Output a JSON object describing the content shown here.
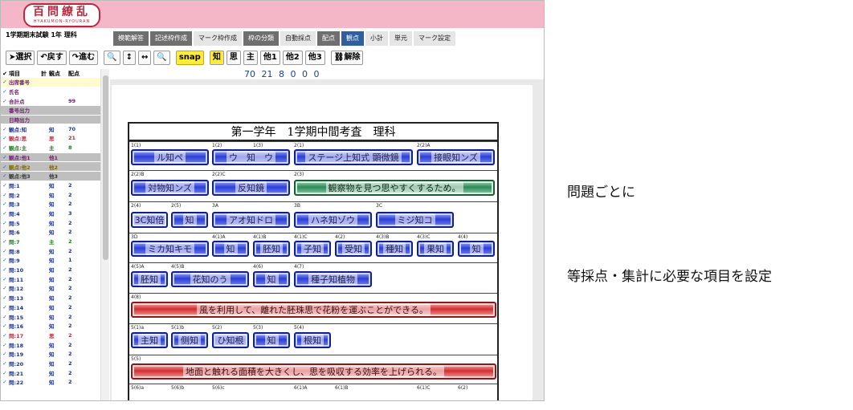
{
  "app": {
    "logo_main": "百問繚乱",
    "logo_sub": "HYAKUMON-RYOURAN",
    "exam_title": "1学期期末試験 1年 理科"
  },
  "tabs": [
    {
      "label": "模範解答",
      "style": "dark"
    },
    {
      "label": "記述枠作成",
      "style": "dark"
    },
    {
      "label": "マーク枠作成",
      "style": "light"
    },
    {
      "label": "枠の分類",
      "style": "dark"
    },
    {
      "label": "自動採点",
      "style": "light"
    },
    {
      "label": "配点",
      "style": "dark"
    },
    {
      "label": "観点",
      "style": "blue"
    },
    {
      "label": "小計",
      "style": "light"
    },
    {
      "label": "単元",
      "style": "light"
    },
    {
      "label": "マーク設定",
      "style": "light"
    }
  ],
  "toolbar": {
    "select": "選択",
    "undo": "戻す",
    "redo": "進む",
    "zoom_out": "🔍",
    "fit_height": "↕",
    "fit_width": "↔",
    "zoom_in": "🔍",
    "snap": "snap",
    "kan1": "知",
    "kan2": "思",
    "kan3": "主",
    "other1": "他1",
    "other2": "他2",
    "other3": "他3",
    "clear": "解除"
  },
  "counts": "70 21 8 0 0 0",
  "side": {
    "header": {
      "check": "✔",
      "item": "項目",
      "total": "計",
      "kanten": "観点",
      "points": "配点"
    },
    "rows": [
      {
        "c": "✓",
        "n": "出席番号",
        "k": "",
        "p": "",
        "bg": "hy",
        "color": "cl-purple"
      },
      {
        "c": "✓",
        "n": "氏名",
        "k": "",
        "p": "",
        "bg": "",
        "color": "cl-purple"
      },
      {
        "c": "✓",
        "n": "合計点",
        "k": "",
        "p": "99",
        "bg": "",
        "color": "cl-purple"
      },
      {
        "c": "",
        "n": "番号出力",
        "k": "",
        "p": "",
        "bg": "hg",
        "color": "cl-purple"
      },
      {
        "c": "",
        "n": "日時出力",
        "k": "",
        "p": "",
        "bg": "hg",
        "color": "cl-purple"
      },
      {
        "c": "✓",
        "n": "観点:知",
        "k": "知",
        "p": "70",
        "bg": "",
        "color": "cl-blue"
      },
      {
        "c": "✓",
        "n": "観点:思",
        "k": "思",
        "p": "21",
        "bg": "",
        "color": "cl-red"
      },
      {
        "c": "✓",
        "n": "観点:主",
        "k": "主",
        "p": "8",
        "bg": "",
        "color": "cl-green"
      },
      {
        "c": "✓",
        "n": "観点:他1",
        "k": "他1",
        "p": "",
        "bg": "hg",
        "color": "cl-purple"
      },
      {
        "c": "✓",
        "n": "観点:他2",
        "k": "他2",
        "p": "",
        "bg": "hg",
        "color": "cl-olive"
      },
      {
        "c": "✓",
        "n": "観点:他3",
        "k": "他3",
        "p": "",
        "bg": "hg",
        "color": "cl-dark"
      },
      {
        "c": "✓",
        "n": "問:1",
        "k": "知",
        "p": "2",
        "bg": "",
        "color": "cl-blue"
      },
      {
        "c": "✓",
        "n": "問:2",
        "k": "知",
        "p": "2",
        "bg": "",
        "color": "cl-blue"
      },
      {
        "c": "✓",
        "n": "問:3",
        "k": "知",
        "p": "2",
        "bg": "",
        "color": "cl-blue"
      },
      {
        "c": "✓",
        "n": "問:4",
        "k": "知",
        "p": "3",
        "bg": "",
        "color": "cl-blue"
      },
      {
        "c": "✓",
        "n": "問:5",
        "k": "知",
        "p": "2",
        "bg": "",
        "color": "cl-blue"
      },
      {
        "c": "✓",
        "n": "問:6",
        "k": "知",
        "p": "2",
        "bg": "",
        "color": "cl-blue"
      },
      {
        "c": "✓",
        "n": "問:7",
        "k": "主",
        "p": "2",
        "bg": "",
        "color": "cl-green"
      },
      {
        "c": "✓",
        "n": "問:8",
        "k": "知",
        "p": "2",
        "bg": "",
        "color": "cl-blue"
      },
      {
        "c": "✓",
        "n": "問:9",
        "k": "知",
        "p": "1",
        "bg": "",
        "color": "cl-blue"
      },
      {
        "c": "✓",
        "n": "問:10",
        "k": "知",
        "p": "2",
        "bg": "",
        "color": "cl-blue"
      },
      {
        "c": "✓",
        "n": "問:11",
        "k": "知",
        "p": "2",
        "bg": "",
        "color": "cl-blue"
      },
      {
        "c": "✓",
        "n": "問:12",
        "k": "知",
        "p": "2",
        "bg": "",
        "color": "cl-blue"
      },
      {
        "c": "✓",
        "n": "問:13",
        "k": "知",
        "p": "2",
        "bg": "",
        "color": "cl-blue"
      },
      {
        "c": "✓",
        "n": "問:14",
        "k": "知",
        "p": "2",
        "bg": "",
        "color": "cl-blue"
      },
      {
        "c": "✓",
        "n": "問:15",
        "k": "知",
        "p": "2",
        "bg": "",
        "color": "cl-blue"
      },
      {
        "c": "✓",
        "n": "問:16",
        "k": "知",
        "p": "2",
        "bg": "",
        "color": "cl-blue"
      },
      {
        "c": "✓",
        "n": "問:17",
        "k": "思",
        "p": "2",
        "bg": "",
        "color": "cl-red"
      },
      {
        "c": "✓",
        "n": "問:18",
        "k": "知",
        "p": "2",
        "bg": "",
        "color": "cl-blue"
      },
      {
        "c": "✓",
        "n": "問:19",
        "k": "知",
        "p": "2",
        "bg": "",
        "color": "cl-blue"
      },
      {
        "c": "✓",
        "n": "問:20",
        "k": "知",
        "p": "2",
        "bg": "",
        "color": "cl-blue"
      },
      {
        "c": "✓",
        "n": "問:21",
        "k": "知",
        "p": "2",
        "bg": "",
        "color": "cl-blue"
      },
      {
        "c": "✓",
        "n": "問:22",
        "k": "知",
        "p": "2",
        "bg": "",
        "color": "cl-blue"
      }
    ]
  },
  "sheet": {
    "title": "第一学年　1学期中間考査　理科",
    "labels": [
      "1(1)",
      "1(2)",
      "1(3)",
      "2(1)",
      "2(2)A",
      "2(2)B",
      "2(2)C",
      "2(3)",
      "2(4)",
      "2(5)",
      "3A",
      "3B",
      "3C",
      "3D",
      "4(1)A",
      "4(1)B",
      "4(1)C",
      "4(2)",
      "4(3)B",
      "4(3)C",
      "4(4)",
      "4(5)A",
      "4(5)B",
      "4(6)",
      "4(7)",
      "4(8)",
      "5(1)a",
      "5(1)b",
      "5(2)",
      "5(3)",
      "5(4)",
      "5(5)",
      "5(6)a",
      "5(6)b",
      "5(6)c",
      "6(1)A",
      "6(1)B",
      "6(1)C",
      "6(2)"
    ],
    "boxes": [
      "ル知ペ",
      "ウ　知　ウ",
      "ステージ上知式 顕微鏡",
      "接眼知ンズ",
      "対物知ンズ",
      "反知鏡",
      "観察物を見つ思やすくするため。",
      "3C知倍",
      "知",
      "アオ知ドロ",
      "ハネ知ゾウ",
      "ミジ知コ",
      "ミカ知キモ",
      "知",
      "胚知",
      "子知",
      "受知",
      "種知",
      "果知",
      "知",
      "胚知",
      "花知のう",
      "知",
      "種子知植物",
      "風を利用して、離れた胚珠思で花粉を運ぶことができる。",
      "主知",
      "侧知",
      "ひ知根",
      "知",
      "根知",
      "地面と触れる面積を大きくし、思を吸収する効率を上げられる。"
    ]
  },
  "notes": {
    "line1": "問題ごとに",
    "line2": "等採点・集計に必要な項目を設定"
  },
  "colors": {
    "banner": "#f3b7c8",
    "tab_blue": "#2f5f9e",
    "snap_yellow": "#ffeb3b",
    "box_blue": "#2c3fd9",
    "box_green": "#2e8a5a",
    "box_red": "#d22f2f"
  }
}
